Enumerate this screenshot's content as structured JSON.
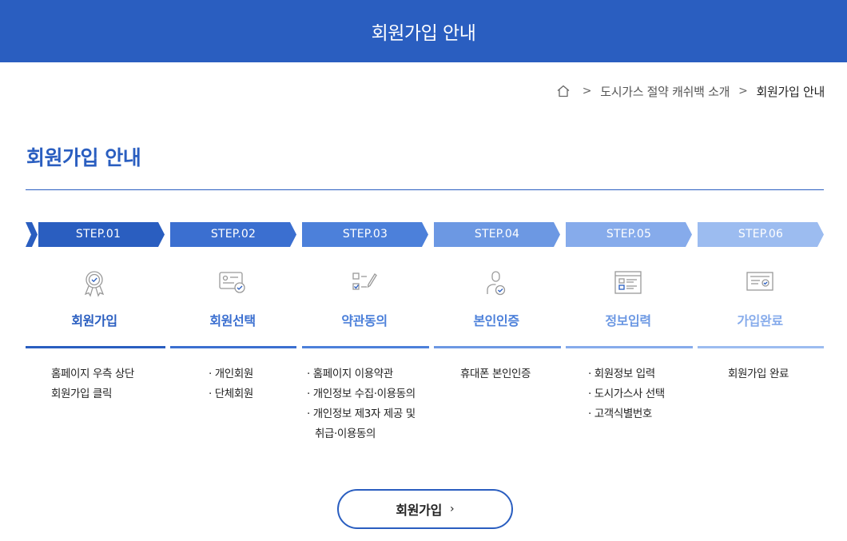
{
  "header": {
    "title": "회원가입 안내"
  },
  "breadcrumb": {
    "home_icon": "home-icon",
    "items": [
      "도시가스 절약 캐쉬백 소개",
      "회원가입 안내"
    ],
    "separator": ">"
  },
  "page": {
    "title": "회원가입 안내"
  },
  "colors": {
    "primary": "#2a5ec0",
    "steps": [
      "#2a5ec0",
      "#3b6fd0",
      "#4c80da",
      "#6c98e3",
      "#86abeb",
      "#9cbcf0"
    ]
  },
  "steps": [
    {
      "label": "STEP.01",
      "name": "회원가입",
      "icon": "award-ribbon-icon",
      "desc": [
        "홈페이지 우측 상단",
        "회원가입 클릭"
      ]
    },
    {
      "label": "STEP.02",
      "name": "회원선택",
      "icon": "id-card-check-icon",
      "desc": [
        "· 개인회원",
        "· 단체회원"
      ]
    },
    {
      "label": "STEP.03",
      "name": "약관동의",
      "icon": "checklist-pen-icon",
      "desc": [
        "· 홈페이지 이용약관",
        "· 개인정보 수집·이용동의",
        "· 개인정보 제3자 제공 및",
        "취급·이용동의"
      ]
    },
    {
      "label": "STEP.04",
      "name": "본인인증",
      "icon": "user-verify-icon",
      "desc": [
        "휴대폰 본인인증"
      ]
    },
    {
      "label": "STEP.05",
      "name": "정보입력",
      "icon": "form-window-icon",
      "desc": [
        "· 회원정보 입력",
        "· 도시가스사 선택",
        "· 고객식별번호"
      ]
    },
    {
      "label": "STEP.06",
      "name": "가입완료",
      "icon": "certificate-check-icon",
      "desc": [
        "회원가입 완료"
      ]
    }
  ],
  "cta": {
    "label": "회원가입",
    "chevron": "›"
  }
}
